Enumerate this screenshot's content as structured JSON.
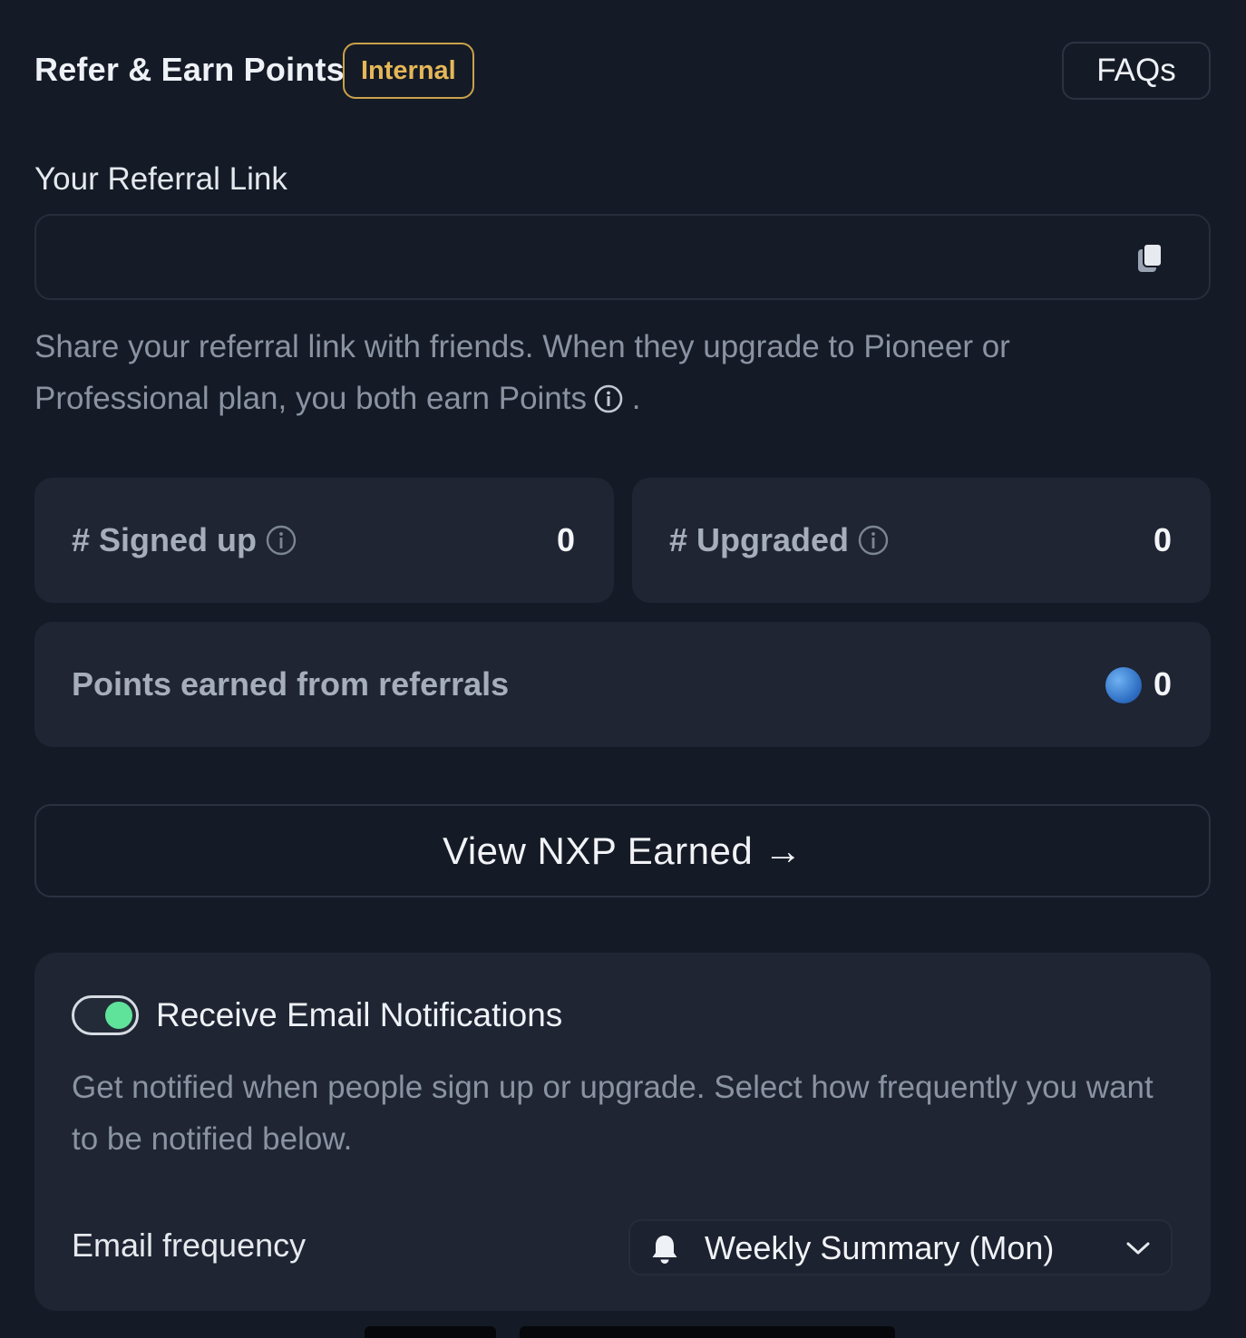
{
  "header": {
    "title": "Refer & Earn Points",
    "badge": "Internal",
    "faq_label": "FAQs"
  },
  "referral": {
    "label": "Your Referral Link",
    "link_value": "",
    "description": "Share your referral link with friends. When they upgrade to Pioneer or Professional plan, you both earn Points",
    "description_end": "."
  },
  "stats": {
    "signed_up": {
      "label": "# Signed up",
      "value": "0"
    },
    "upgraded": {
      "label": "# Upgraded",
      "value": "0"
    },
    "points": {
      "label": "Points earned from referrals",
      "value": "0"
    }
  },
  "view_button": {
    "label": "View NXP Earned →"
  },
  "notifications": {
    "toggle_on": true,
    "title": "Receive Email Notifications",
    "description": "Get notified when people sign up or upgrade. Select how frequently you want to be notified below.",
    "frequency_label": "Email frequency",
    "frequency_value": "Weekly Summary (Mon)"
  },
  "colors": {
    "background": "#151b26",
    "card": "#1f2533",
    "badge_gold": "#e6b758",
    "toggle_green": "#5fe39a",
    "coin_blue": "#3f86d8"
  },
  "icons": [
    "copy-icon",
    "info-icon",
    "points-coin-icon",
    "bell-icon",
    "chevron-down-icon"
  ]
}
